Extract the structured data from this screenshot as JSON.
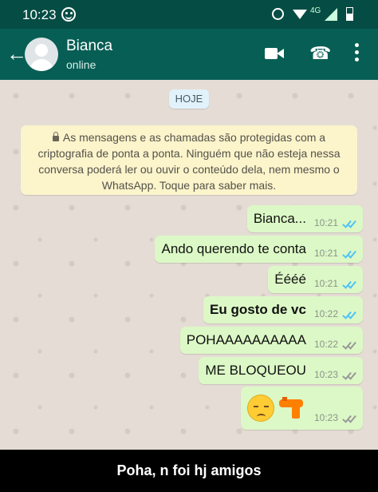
{
  "statusbar": {
    "time": "10:23",
    "network": "4G",
    "icons": [
      "smiley-icon",
      "alarm-icon",
      "wifi-icon",
      "signal-icon",
      "battery-icon"
    ]
  },
  "header": {
    "back_icon": "arrow-left-icon",
    "contact_name": "Bianca",
    "status": "online",
    "actions": [
      "video-call-icon",
      "phone-call-icon",
      "more-options-icon"
    ],
    "color": "#075e54"
  },
  "chat": {
    "date_label": "HOJE",
    "encryption_notice": "As mensagens e as chamadas são protegidas com a criptografia de ponta a ponta. Ninguém que não esteja nessa conversa poderá ler ou ouvir o conteúdo dela, nem mesmo o WhatsApp. Toque para saber mais.",
    "messages": [
      {
        "text": "Bianca...",
        "time": "10:21",
        "read": true
      },
      {
        "text": "Ando querendo te conta",
        "time": "10:21",
        "read": true
      },
      {
        "text": "Éééé",
        "time": "10:21",
        "read": true
      },
      {
        "text": "Eu gosto de vc",
        "time": "10:22",
        "read": true,
        "bold": true
      },
      {
        "text": "POHAAAAAAAAAA",
        "time": "10:22",
        "read": false
      },
      {
        "text": "ME BLOQUEOU",
        "time": "10:23",
        "read": false
      },
      {
        "emojis": [
          "pensive-face-icon",
          "water-pistol-icon"
        ],
        "time": "10:23",
        "read": false
      }
    ]
  },
  "caption": "Poha, n foi hj amigos"
}
